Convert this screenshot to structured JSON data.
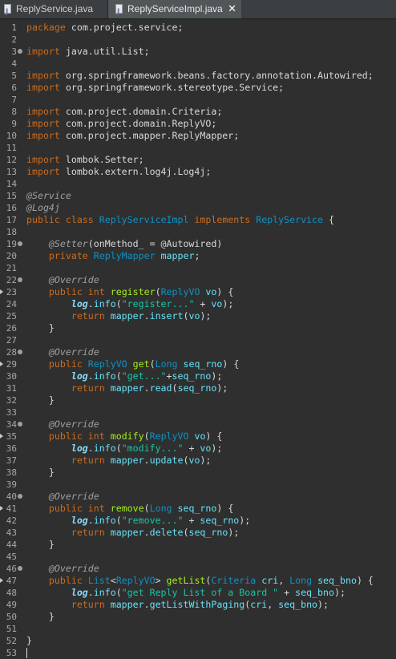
{
  "tabs": [
    {
      "label": "ReplyService.java",
      "active": false
    },
    {
      "label": "ReplyServiceImpl.java",
      "active": true,
      "close": "✕"
    }
  ],
  "colors": {
    "keyword": "#cc6c1d",
    "type": "#1290c3",
    "annotation": "#a0a0a0",
    "variable": "#66e1f8",
    "field": "#8ddaf8",
    "string": "#17c6a3",
    "method": "#a7ec21",
    "plain": "#d8d8d8",
    "background": "#2f2f2f"
  },
  "editor": {
    "lines": [
      {
        "n": "1",
        "marker": "none",
        "tokens": [
          [
            "kw",
            "package"
          ],
          [
            "pl",
            " com.project.service;"
          ]
        ]
      },
      {
        "n": "2",
        "marker": "none",
        "tokens": []
      },
      {
        "n": "3",
        "marker": "fold",
        "tokens": [
          [
            "kw",
            "import"
          ],
          [
            "pl",
            " java.util.List;"
          ]
        ]
      },
      {
        "n": "4",
        "marker": "none",
        "tokens": []
      },
      {
        "n": "5",
        "marker": "none",
        "tokens": [
          [
            "kw",
            "import"
          ],
          [
            "pl",
            " org.springframework.beans.factory.annotation.Autowired;"
          ]
        ]
      },
      {
        "n": "6",
        "marker": "none",
        "tokens": [
          [
            "kw",
            "import"
          ],
          [
            "pl",
            " org.springframework.stereotype.Service;"
          ]
        ]
      },
      {
        "n": "7",
        "marker": "none",
        "tokens": []
      },
      {
        "n": "8",
        "marker": "none",
        "tokens": [
          [
            "kw",
            "import"
          ],
          [
            "pl",
            " com.project.domain.Criteria;"
          ]
        ]
      },
      {
        "n": "9",
        "marker": "none",
        "tokens": [
          [
            "kw",
            "import"
          ],
          [
            "pl",
            " com.project.domain.ReplyVO;"
          ]
        ]
      },
      {
        "n": "10",
        "marker": "none",
        "tokens": [
          [
            "kw",
            "import"
          ],
          [
            "pl",
            " com.project.mapper.ReplyMapper;"
          ]
        ]
      },
      {
        "n": "11",
        "marker": "none",
        "tokens": []
      },
      {
        "n": "12",
        "marker": "none",
        "tokens": [
          [
            "kw",
            "import"
          ],
          [
            "pl",
            " lombok.Setter;"
          ]
        ]
      },
      {
        "n": "13",
        "marker": "none",
        "tokens": [
          [
            "kw",
            "import"
          ],
          [
            "pl",
            " lombok.extern.log4j.Log4j;"
          ]
        ]
      },
      {
        "n": "14",
        "marker": "none",
        "tokens": []
      },
      {
        "n": "15",
        "marker": "none",
        "tokens": [
          [
            "ann",
            "@Service"
          ]
        ]
      },
      {
        "n": "16",
        "marker": "none",
        "tokens": [
          [
            "ann",
            "@Log4j"
          ]
        ]
      },
      {
        "n": "17",
        "marker": "none",
        "tokens": [
          [
            "kw",
            "public"
          ],
          [
            "pl",
            " "
          ],
          [
            "kw",
            "class"
          ],
          [
            "pl",
            " "
          ],
          [
            "ty",
            "ReplyServiceImpl"
          ],
          [
            "pl",
            " "
          ],
          [
            "kw",
            "implements"
          ],
          [
            "pl",
            " "
          ],
          [
            "ty",
            "ReplyService"
          ],
          [
            "pl",
            " {"
          ]
        ]
      },
      {
        "n": "18",
        "marker": "none",
        "tokens": []
      },
      {
        "n": "19",
        "marker": "fold",
        "tokens": [
          [
            "pl",
            "    "
          ],
          [
            "ann",
            "@Setter"
          ],
          [
            "pl",
            "(onMethod_ = @Autowired)"
          ]
        ]
      },
      {
        "n": "20",
        "marker": "none",
        "tokens": [
          [
            "pl",
            "    "
          ],
          [
            "kw",
            "private"
          ],
          [
            "pl",
            " "
          ],
          [
            "ty",
            "ReplyMapper"
          ],
          [
            "pl",
            " "
          ],
          [
            "var",
            "mapper"
          ],
          [
            "pl",
            ";"
          ]
        ]
      },
      {
        "n": "21",
        "marker": "none",
        "tokens": []
      },
      {
        "n": "22",
        "marker": "fold",
        "tokens": [
          [
            "pl",
            "    "
          ],
          [
            "ann",
            "@Override"
          ]
        ]
      },
      {
        "n": "23",
        "marker": "override",
        "tokens": [
          [
            "pl",
            "    "
          ],
          [
            "kw",
            "public"
          ],
          [
            "pl",
            " "
          ],
          [
            "kw",
            "int"
          ],
          [
            "pl",
            " "
          ],
          [
            "mth",
            "register"
          ],
          [
            "pl",
            "("
          ],
          [
            "ty",
            "ReplyVO"
          ],
          [
            "pl",
            " "
          ],
          [
            "var",
            "vo"
          ],
          [
            "pl",
            ") {"
          ]
        ]
      },
      {
        "n": "24",
        "marker": "none",
        "tokens": [
          [
            "pl",
            "        "
          ],
          [
            "fld",
            "log"
          ],
          [
            "pl",
            "."
          ],
          [
            "var",
            "info"
          ],
          [
            "pl",
            "("
          ],
          [
            "str",
            "\"register...\""
          ],
          [
            "pl",
            " + "
          ],
          [
            "var",
            "vo"
          ],
          [
            "pl",
            ");"
          ]
        ]
      },
      {
        "n": "25",
        "marker": "none",
        "tokens": [
          [
            "pl",
            "        "
          ],
          [
            "kw",
            "return"
          ],
          [
            "pl",
            " "
          ],
          [
            "var",
            "mapper"
          ],
          [
            "pl",
            "."
          ],
          [
            "var",
            "insert"
          ],
          [
            "pl",
            "("
          ],
          [
            "var",
            "vo"
          ],
          [
            "pl",
            ");"
          ]
        ]
      },
      {
        "n": "26",
        "marker": "none",
        "tokens": [
          [
            "pl",
            "    }"
          ]
        ]
      },
      {
        "n": "27",
        "marker": "none",
        "tokens": []
      },
      {
        "n": "28",
        "marker": "fold",
        "tokens": [
          [
            "pl",
            "    "
          ],
          [
            "ann",
            "@Override"
          ]
        ]
      },
      {
        "n": "29",
        "marker": "override",
        "tokens": [
          [
            "pl",
            "    "
          ],
          [
            "kw",
            "public"
          ],
          [
            "pl",
            " "
          ],
          [
            "ty",
            "ReplyVO"
          ],
          [
            "pl",
            " "
          ],
          [
            "mth",
            "get"
          ],
          [
            "pl",
            "("
          ],
          [
            "ty",
            "Long"
          ],
          [
            "pl",
            " "
          ],
          [
            "var",
            "seq_rno"
          ],
          [
            "pl",
            ") {"
          ]
        ]
      },
      {
        "n": "30",
        "marker": "none",
        "tokens": [
          [
            "pl",
            "        "
          ],
          [
            "fld",
            "log"
          ],
          [
            "pl",
            "."
          ],
          [
            "var",
            "info"
          ],
          [
            "pl",
            "("
          ],
          [
            "str",
            "\"get...\""
          ],
          [
            "pl",
            "+"
          ],
          [
            "var",
            "seq_rno"
          ],
          [
            "pl",
            ");"
          ]
        ]
      },
      {
        "n": "31",
        "marker": "none",
        "tokens": [
          [
            "pl",
            "        "
          ],
          [
            "kw",
            "return"
          ],
          [
            "pl",
            " "
          ],
          [
            "var",
            "mapper"
          ],
          [
            "pl",
            "."
          ],
          [
            "var",
            "read"
          ],
          [
            "pl",
            "("
          ],
          [
            "var",
            "seq_rno"
          ],
          [
            "pl",
            ");"
          ]
        ]
      },
      {
        "n": "32",
        "marker": "none",
        "tokens": [
          [
            "pl",
            "    }"
          ]
        ]
      },
      {
        "n": "33",
        "marker": "none",
        "tokens": []
      },
      {
        "n": "34",
        "marker": "fold",
        "tokens": [
          [
            "pl",
            "    "
          ],
          [
            "ann",
            "@Override"
          ]
        ]
      },
      {
        "n": "35",
        "marker": "override",
        "tokens": [
          [
            "pl",
            "    "
          ],
          [
            "kw",
            "public"
          ],
          [
            "pl",
            " "
          ],
          [
            "kw",
            "int"
          ],
          [
            "pl",
            " "
          ],
          [
            "mth",
            "modify"
          ],
          [
            "pl",
            "("
          ],
          [
            "ty",
            "ReplyVO"
          ],
          [
            "pl",
            " "
          ],
          [
            "var",
            "vo"
          ],
          [
            "pl",
            ") {"
          ]
        ]
      },
      {
        "n": "36",
        "marker": "none",
        "tokens": [
          [
            "pl",
            "        "
          ],
          [
            "fld",
            "log"
          ],
          [
            "pl",
            "."
          ],
          [
            "var",
            "info"
          ],
          [
            "pl",
            "("
          ],
          [
            "str",
            "\"modify...\""
          ],
          [
            "pl",
            " + "
          ],
          [
            "var",
            "vo"
          ],
          [
            "pl",
            ");"
          ]
        ]
      },
      {
        "n": "37",
        "marker": "none",
        "tokens": [
          [
            "pl",
            "        "
          ],
          [
            "kw",
            "return"
          ],
          [
            "pl",
            " "
          ],
          [
            "var",
            "mapper"
          ],
          [
            "pl",
            "."
          ],
          [
            "var",
            "update"
          ],
          [
            "pl",
            "("
          ],
          [
            "var",
            "vo"
          ],
          [
            "pl",
            ");"
          ]
        ]
      },
      {
        "n": "38",
        "marker": "none",
        "tokens": [
          [
            "pl",
            "    }"
          ]
        ]
      },
      {
        "n": "39",
        "marker": "none",
        "tokens": []
      },
      {
        "n": "40",
        "marker": "fold",
        "tokens": [
          [
            "pl",
            "    "
          ],
          [
            "ann",
            "@Override"
          ]
        ]
      },
      {
        "n": "41",
        "marker": "override",
        "tokens": [
          [
            "pl",
            "    "
          ],
          [
            "kw",
            "public"
          ],
          [
            "pl",
            " "
          ],
          [
            "kw",
            "int"
          ],
          [
            "pl",
            " "
          ],
          [
            "mth",
            "remove"
          ],
          [
            "pl",
            "("
          ],
          [
            "ty",
            "Long"
          ],
          [
            "pl",
            " "
          ],
          [
            "var",
            "seq_rno"
          ],
          [
            "pl",
            ") {"
          ]
        ]
      },
      {
        "n": "42",
        "marker": "none",
        "tokens": [
          [
            "pl",
            "        "
          ],
          [
            "fld",
            "log"
          ],
          [
            "pl",
            "."
          ],
          [
            "var",
            "info"
          ],
          [
            "pl",
            "("
          ],
          [
            "str",
            "\"remove...\""
          ],
          [
            "pl",
            " + "
          ],
          [
            "var",
            "seq_rno"
          ],
          [
            "pl",
            ");"
          ]
        ]
      },
      {
        "n": "43",
        "marker": "none",
        "tokens": [
          [
            "pl",
            "        "
          ],
          [
            "kw",
            "return"
          ],
          [
            "pl",
            " "
          ],
          [
            "var",
            "mapper"
          ],
          [
            "pl",
            "."
          ],
          [
            "var",
            "delete"
          ],
          [
            "pl",
            "("
          ],
          [
            "var",
            "seq_rno"
          ],
          [
            "pl",
            ");"
          ]
        ]
      },
      {
        "n": "44",
        "marker": "none",
        "tokens": [
          [
            "pl",
            "    }"
          ]
        ]
      },
      {
        "n": "45",
        "marker": "none",
        "tokens": []
      },
      {
        "n": "46",
        "marker": "fold",
        "tokens": [
          [
            "pl",
            "    "
          ],
          [
            "ann",
            "@Override"
          ]
        ]
      },
      {
        "n": "47",
        "marker": "override",
        "tokens": [
          [
            "pl",
            "    "
          ],
          [
            "kw",
            "public"
          ],
          [
            "pl",
            " "
          ],
          [
            "ty",
            "List"
          ],
          [
            "pl",
            "<"
          ],
          [
            "ty",
            "ReplyVO"
          ],
          [
            "pl",
            "> "
          ],
          [
            "mth",
            "getList"
          ],
          [
            "pl",
            "("
          ],
          [
            "ty",
            "Criteria"
          ],
          [
            "pl",
            " "
          ],
          [
            "var",
            "cri"
          ],
          [
            "pl",
            ", "
          ],
          [
            "ty",
            "Long"
          ],
          [
            "pl",
            " "
          ],
          [
            "var",
            "seq_bno"
          ],
          [
            "pl",
            ") {"
          ]
        ]
      },
      {
        "n": "48",
        "marker": "none",
        "tokens": [
          [
            "pl",
            "        "
          ],
          [
            "fld",
            "log"
          ],
          [
            "pl",
            "."
          ],
          [
            "var",
            "info"
          ],
          [
            "pl",
            "("
          ],
          [
            "str",
            "\"get Reply List of a Board \""
          ],
          [
            "pl",
            " + "
          ],
          [
            "var",
            "seq_bno"
          ],
          [
            "pl",
            ");"
          ]
        ]
      },
      {
        "n": "49",
        "marker": "none",
        "tokens": [
          [
            "pl",
            "        "
          ],
          [
            "kw",
            "return"
          ],
          [
            "pl",
            " "
          ],
          [
            "var",
            "mapper"
          ],
          [
            "pl",
            "."
          ],
          [
            "var",
            "getListWithPaging"
          ],
          [
            "pl",
            "("
          ],
          [
            "var",
            "cri"
          ],
          [
            "pl",
            ", "
          ],
          [
            "var",
            "seq_bno"
          ],
          [
            "pl",
            ");"
          ]
        ]
      },
      {
        "n": "50",
        "marker": "none",
        "tokens": [
          [
            "pl",
            "    }"
          ]
        ]
      },
      {
        "n": "51",
        "marker": "none",
        "tokens": []
      },
      {
        "n": "52",
        "marker": "none",
        "tokens": [
          [
            "pl",
            "}"
          ]
        ]
      },
      {
        "n": "53",
        "marker": "cursor",
        "tokens": []
      }
    ]
  }
}
